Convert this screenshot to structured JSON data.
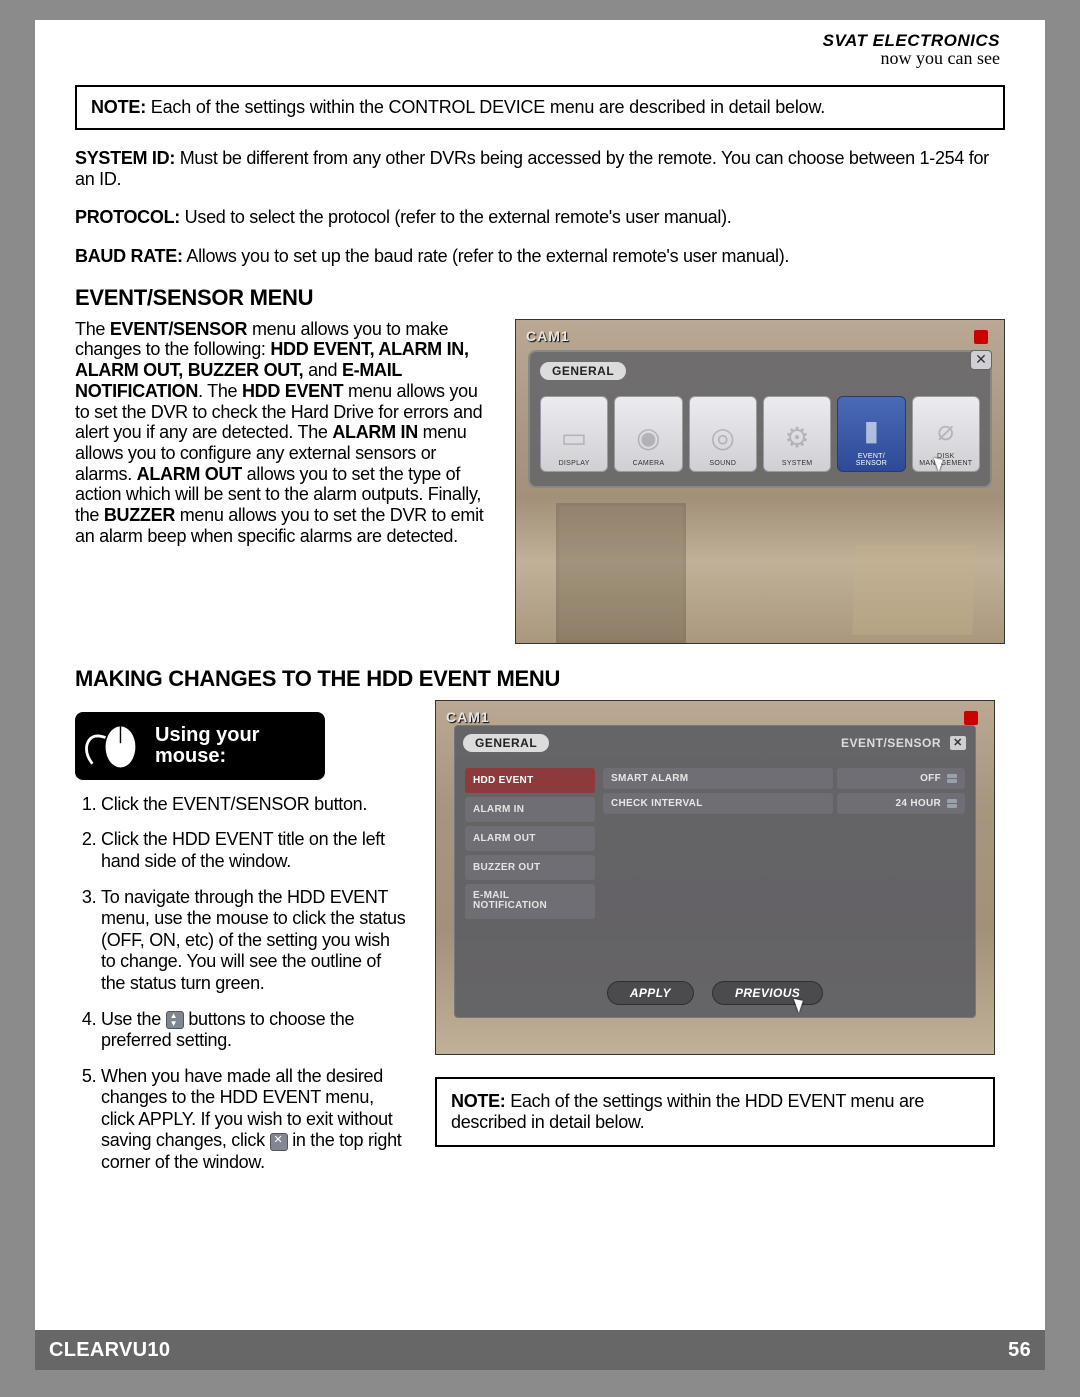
{
  "brand": {
    "line1": "SVAT ELECTRONICS",
    "line2": "now you can see"
  },
  "note1": {
    "label": "NOTE:",
    "text": " Each of the settings within the CONTROL DEVICE menu are described in detail below."
  },
  "defs": {
    "system_id": {
      "k": "SYSTEM ID:",
      "v": " Must be different from any other DVRs being accessed by the remote.  You can choose between 1-254 for an ID."
    },
    "protocol": {
      "k": "PROTOCOL:",
      "v": " Used to select the protocol (refer to the external remote's user manual)."
    },
    "baud": {
      "k": "BAUD RATE:",
      "v": "  Allows you to set up the baud rate (refer to the external remote's user manual)."
    }
  },
  "section1": "EVENT/SENSOR MENU",
  "event_para": {
    "p1a": "The ",
    "b1": "EVENT/SENSOR",
    "p1b": " menu allows you to make changes to the following: ",
    "b2": "HDD EVENT, ALARM IN, ALARM OUT, BUZZER OUT,",
    "p2": " and ",
    "b3": "E-MAIL NOTIFICATION",
    "p3": ".  The ",
    "b4": "HDD EVENT",
    "p4": " menu allows you to set the DVR to check the Hard Drive for errors and alert you if any are detected.  The ",
    "b5": "ALARM IN",
    "p5": " menu allows you to configure any external sensors or alarms.  ",
    "b6": "ALARM OUT",
    "p6": " allows you to set the type of action which will be sent to the alarm outputs.  Finally, the ",
    "b7": "BUZZER",
    "p7": " menu allows you to set the DVR to emit an alarm beep when specific alarms are detected."
  },
  "shot1": {
    "cam": "CAM1",
    "tab": "GENERAL",
    "icons": [
      "DISPLAY",
      "CAMERA",
      "SOUND",
      "SYSTEM",
      "EVENT/\nSENSOR",
      "DISK\nMANAGEMENT"
    ],
    "selected_index": 4
  },
  "section2": "MAKING CHANGES TO THE HDD EVENT MENU",
  "mouse": {
    "l1": "Using your",
    "l2": "mouse:"
  },
  "steps": {
    "s1": "Click the EVENT/SENSOR button.",
    "s2": "Click the HDD EVENT title on the left hand side of the window.",
    "s3": "To navigate through the HDD EVENT menu, use the mouse to click the status (OFF, ON, etc) of the setting you wish to change.  You will see the outline of the status turn green.",
    "s4a": "Use the ",
    "s4b": " buttons to choose the preferred setting.",
    "s5a": "When you have made all the desired changes to the HDD EVENT menu, click APPLY.  If you wish to exit without saving changes, click ",
    "s5b": " in the top right corner of the window."
  },
  "shot2": {
    "cam": "CAM1",
    "tab": "GENERAL",
    "crumb": "EVENT/SENSOR",
    "side": [
      "HDD EVENT",
      "ALARM IN",
      "ALARM OUT",
      "BUZZER OUT",
      "E-MAIL\nNOTIFICATION"
    ],
    "rows": [
      {
        "k": "SMART ALARM",
        "v": "OFF"
      },
      {
        "k": "CHECK INTERVAL",
        "v": "24  HOUR"
      }
    ],
    "apply": "APPLY",
    "prev": "PREVIOUS"
  },
  "note2": {
    "label": "NOTE:",
    "text": " Each of the settings within the HDD EVENT menu are described in detail below."
  },
  "footer": {
    "model": "CLEARVU10",
    "page": "56"
  }
}
